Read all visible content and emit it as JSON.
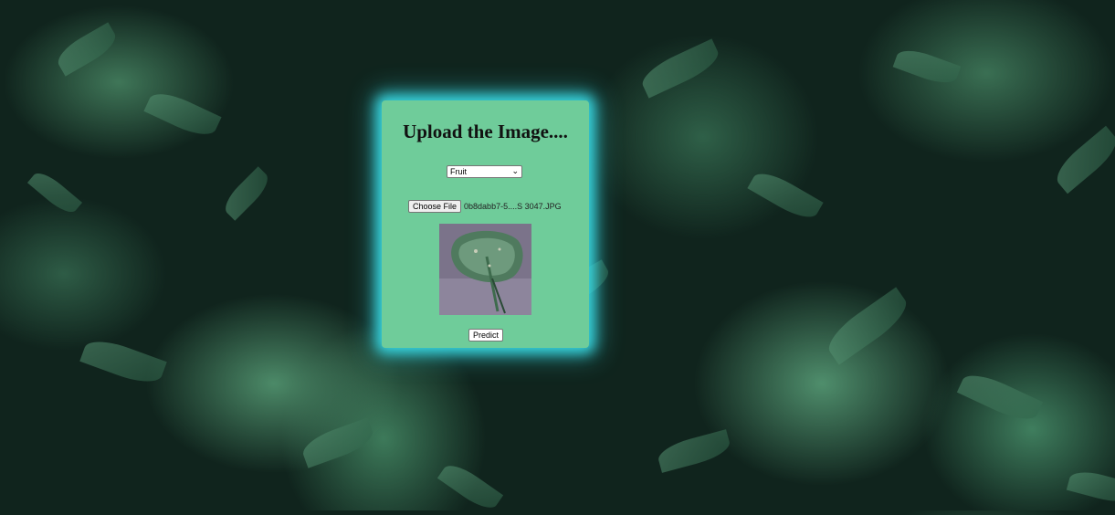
{
  "background": {
    "icon": "fern-leaves-background"
  },
  "form": {
    "title": "Upload the Image....",
    "category_select": {
      "selected": "Fruit"
    },
    "file_input": {
      "button_label": "Choose File",
      "file_name": "0b8dabb7-5....S 3047.JPG"
    },
    "preview": {
      "icon": "leaf-image"
    },
    "predict_label": "Predict"
  },
  "colors": {
    "card_bg": "#6fcc9a",
    "card_glow": "#38d6e0",
    "page_bg": "#10241d"
  }
}
